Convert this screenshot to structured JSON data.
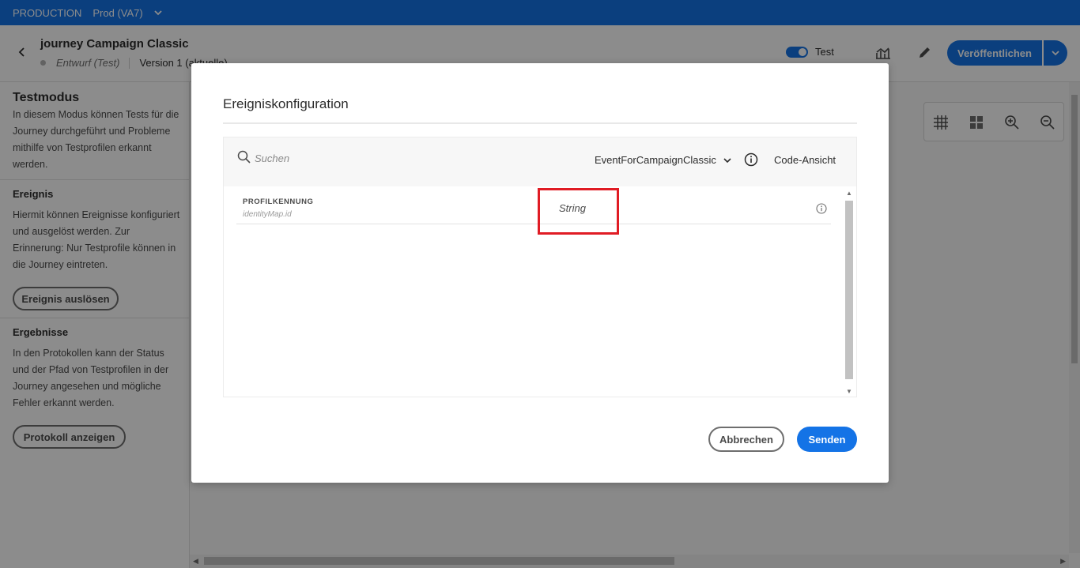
{
  "topbar": {
    "environment": "PRODUCTION",
    "org": "Prod (VA7)"
  },
  "header": {
    "journey_title": "journey Campaign Classic",
    "status": "Entwurf (Test)",
    "version": "Version 1 (aktuelle)",
    "test_label": "Test",
    "publish_label": "Veröffentlichen"
  },
  "left_panel": {
    "testmode_title": "Testmodus",
    "testmode_text": "In diesem Modus können Tests für die Journey durchgeführt und Probleme mithilfe von Testprofilen erkannt werden.",
    "event_title": "Ereignis",
    "event_text": "Hiermit können Ereignisse konfiguriert und ausgelöst werden. Zur Erinnerung: Nur Testprofile können in die Journey eintreten.",
    "event_button": "Ereignis auslösen",
    "results_title": "Ergebnisse",
    "results_text": "In den Protokollen kann der Status und der Pfad von Testprofilen in der Journey angesehen und mögliche Fehler erkannt werden.",
    "log_button": "Protokoll anzeigen"
  },
  "modal": {
    "title": "Ereigniskonfiguration",
    "search_placeholder": "Suchen",
    "event_name": "EventForCampaignClassic",
    "code_view": "Code-Ansicht",
    "rows": [
      {
        "label": "PROFILKENNUNG",
        "path": "identityMap.id",
        "type": "String"
      }
    ],
    "cancel_label": "Abbrechen",
    "send_label": "Senden"
  },
  "colors": {
    "accent": "#1473e6",
    "highlight": "#e01c24"
  }
}
